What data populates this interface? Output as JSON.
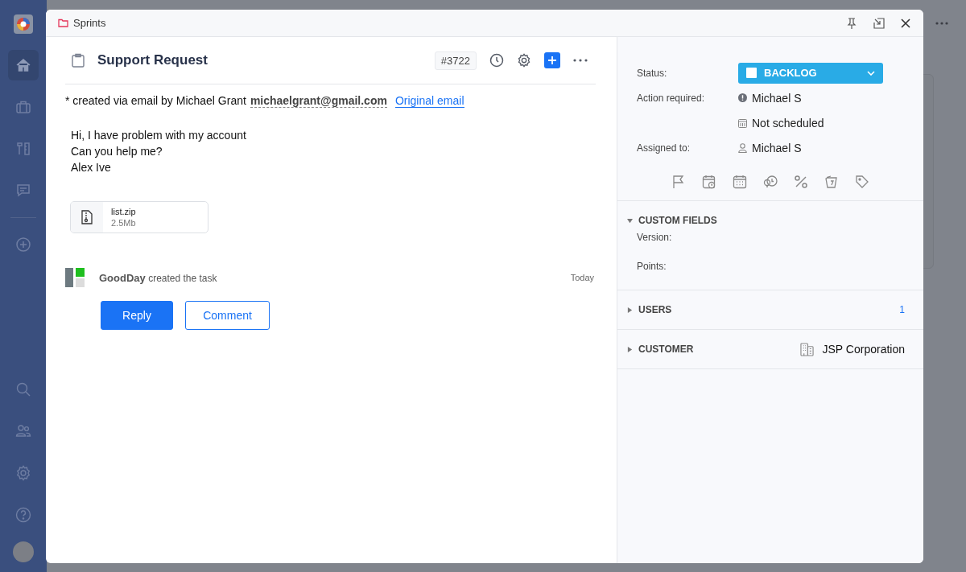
{
  "sidebar": {
    "items": [
      {
        "kind": "home",
        "selected": true
      },
      {
        "kind": "briefcase",
        "selected": false
      },
      {
        "kind": "tools",
        "selected": false
      },
      {
        "kind": "chat",
        "selected": false
      },
      {
        "kind": "add",
        "selected": false
      }
    ],
    "bottom_items": [
      {
        "kind": "search"
      },
      {
        "kind": "users"
      },
      {
        "kind": "settings"
      },
      {
        "kind": "help"
      },
      {
        "kind": "avatar"
      }
    ]
  },
  "modal": {
    "breadcrumb": "Sprints",
    "task": {
      "title": "Support Request",
      "id": "#3722"
    },
    "meta": {
      "prefix": "* created via email by Michael Grant",
      "email": "michaelgrant@gmail.com",
      "link": "Original email"
    },
    "message": [
      "Hi, I have problem with my account",
      "Can you help me?",
      "Alex Ive"
    ],
    "attachment": {
      "name": "list.zip",
      "size": "2.5Mb"
    },
    "activity": {
      "actor": "GoodDay",
      "action": "created the task",
      "time": "Today"
    },
    "buttons": [
      {
        "label": "Reply",
        "kind": "primary"
      },
      {
        "label": "Comment",
        "kind": "outline"
      }
    ],
    "details": {
      "status": {
        "label": "Status:",
        "value": "BACKLOG",
        "color": "#29abe6"
      },
      "action_required": {
        "label": "Action required:",
        "user": "Michael S",
        "schedule": "Not scheduled"
      },
      "assigned": {
        "label": "Assigned to:",
        "user": "Michael S"
      }
    },
    "sections": [
      {
        "title": "CUSTOM FIELDS",
        "expanded": true,
        "fields": [
          "Version:",
          "Points:"
        ]
      },
      {
        "title": "USERS",
        "expanded": false,
        "count": "1"
      },
      {
        "title": "CUSTOMER",
        "expanded": false,
        "value": "JSP Corporation"
      }
    ]
  }
}
